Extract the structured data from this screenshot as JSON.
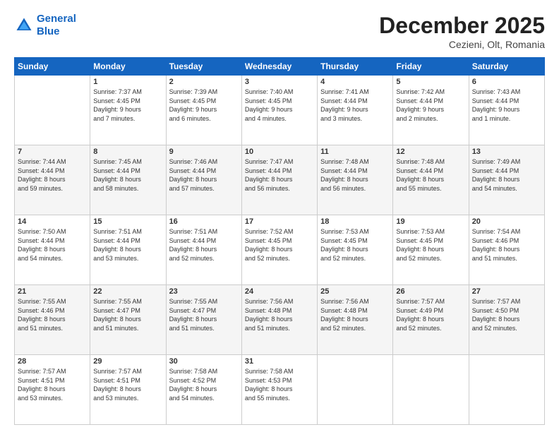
{
  "header": {
    "logo_line1": "General",
    "logo_line2": "Blue",
    "month": "December 2025",
    "location": "Cezieni, Olt, Romania"
  },
  "weekdays": [
    "Sunday",
    "Monday",
    "Tuesday",
    "Wednesday",
    "Thursday",
    "Friday",
    "Saturday"
  ],
  "weeks": [
    [
      {
        "day": "",
        "info": ""
      },
      {
        "day": "1",
        "info": "Sunrise: 7:37 AM\nSunset: 4:45 PM\nDaylight: 9 hours\nand 7 minutes."
      },
      {
        "day": "2",
        "info": "Sunrise: 7:39 AM\nSunset: 4:45 PM\nDaylight: 9 hours\nand 6 minutes."
      },
      {
        "day": "3",
        "info": "Sunrise: 7:40 AM\nSunset: 4:45 PM\nDaylight: 9 hours\nand 4 minutes."
      },
      {
        "day": "4",
        "info": "Sunrise: 7:41 AM\nSunset: 4:44 PM\nDaylight: 9 hours\nand 3 minutes."
      },
      {
        "day": "5",
        "info": "Sunrise: 7:42 AM\nSunset: 4:44 PM\nDaylight: 9 hours\nand 2 minutes."
      },
      {
        "day": "6",
        "info": "Sunrise: 7:43 AM\nSunset: 4:44 PM\nDaylight: 9 hours\nand 1 minute."
      }
    ],
    [
      {
        "day": "7",
        "info": "Sunrise: 7:44 AM\nSunset: 4:44 PM\nDaylight: 8 hours\nand 59 minutes."
      },
      {
        "day": "8",
        "info": "Sunrise: 7:45 AM\nSunset: 4:44 PM\nDaylight: 8 hours\nand 58 minutes."
      },
      {
        "day": "9",
        "info": "Sunrise: 7:46 AM\nSunset: 4:44 PM\nDaylight: 8 hours\nand 57 minutes."
      },
      {
        "day": "10",
        "info": "Sunrise: 7:47 AM\nSunset: 4:44 PM\nDaylight: 8 hours\nand 56 minutes."
      },
      {
        "day": "11",
        "info": "Sunrise: 7:48 AM\nSunset: 4:44 PM\nDaylight: 8 hours\nand 56 minutes."
      },
      {
        "day": "12",
        "info": "Sunrise: 7:48 AM\nSunset: 4:44 PM\nDaylight: 8 hours\nand 55 minutes."
      },
      {
        "day": "13",
        "info": "Sunrise: 7:49 AM\nSunset: 4:44 PM\nDaylight: 8 hours\nand 54 minutes."
      }
    ],
    [
      {
        "day": "14",
        "info": "Sunrise: 7:50 AM\nSunset: 4:44 PM\nDaylight: 8 hours\nand 54 minutes."
      },
      {
        "day": "15",
        "info": "Sunrise: 7:51 AM\nSunset: 4:44 PM\nDaylight: 8 hours\nand 53 minutes."
      },
      {
        "day": "16",
        "info": "Sunrise: 7:51 AM\nSunset: 4:44 PM\nDaylight: 8 hours\nand 52 minutes."
      },
      {
        "day": "17",
        "info": "Sunrise: 7:52 AM\nSunset: 4:45 PM\nDaylight: 8 hours\nand 52 minutes."
      },
      {
        "day": "18",
        "info": "Sunrise: 7:53 AM\nSunset: 4:45 PM\nDaylight: 8 hours\nand 52 minutes."
      },
      {
        "day": "19",
        "info": "Sunrise: 7:53 AM\nSunset: 4:45 PM\nDaylight: 8 hours\nand 52 minutes."
      },
      {
        "day": "20",
        "info": "Sunrise: 7:54 AM\nSunset: 4:46 PM\nDaylight: 8 hours\nand 51 minutes."
      }
    ],
    [
      {
        "day": "21",
        "info": "Sunrise: 7:55 AM\nSunset: 4:46 PM\nDaylight: 8 hours\nand 51 minutes."
      },
      {
        "day": "22",
        "info": "Sunrise: 7:55 AM\nSunset: 4:47 PM\nDaylight: 8 hours\nand 51 minutes."
      },
      {
        "day": "23",
        "info": "Sunrise: 7:55 AM\nSunset: 4:47 PM\nDaylight: 8 hours\nand 51 minutes."
      },
      {
        "day": "24",
        "info": "Sunrise: 7:56 AM\nSunset: 4:48 PM\nDaylight: 8 hours\nand 51 minutes."
      },
      {
        "day": "25",
        "info": "Sunrise: 7:56 AM\nSunset: 4:48 PM\nDaylight: 8 hours\nand 52 minutes."
      },
      {
        "day": "26",
        "info": "Sunrise: 7:57 AM\nSunset: 4:49 PM\nDaylight: 8 hours\nand 52 minutes."
      },
      {
        "day": "27",
        "info": "Sunrise: 7:57 AM\nSunset: 4:50 PM\nDaylight: 8 hours\nand 52 minutes."
      }
    ],
    [
      {
        "day": "28",
        "info": "Sunrise: 7:57 AM\nSunset: 4:51 PM\nDaylight: 8 hours\nand 53 minutes."
      },
      {
        "day": "29",
        "info": "Sunrise: 7:57 AM\nSunset: 4:51 PM\nDaylight: 8 hours\nand 53 minutes."
      },
      {
        "day": "30",
        "info": "Sunrise: 7:58 AM\nSunset: 4:52 PM\nDaylight: 8 hours\nand 54 minutes."
      },
      {
        "day": "31",
        "info": "Sunrise: 7:58 AM\nSunset: 4:53 PM\nDaylight: 8 hours\nand 55 minutes."
      },
      {
        "day": "",
        "info": ""
      },
      {
        "day": "",
        "info": ""
      },
      {
        "day": "",
        "info": ""
      }
    ]
  ]
}
